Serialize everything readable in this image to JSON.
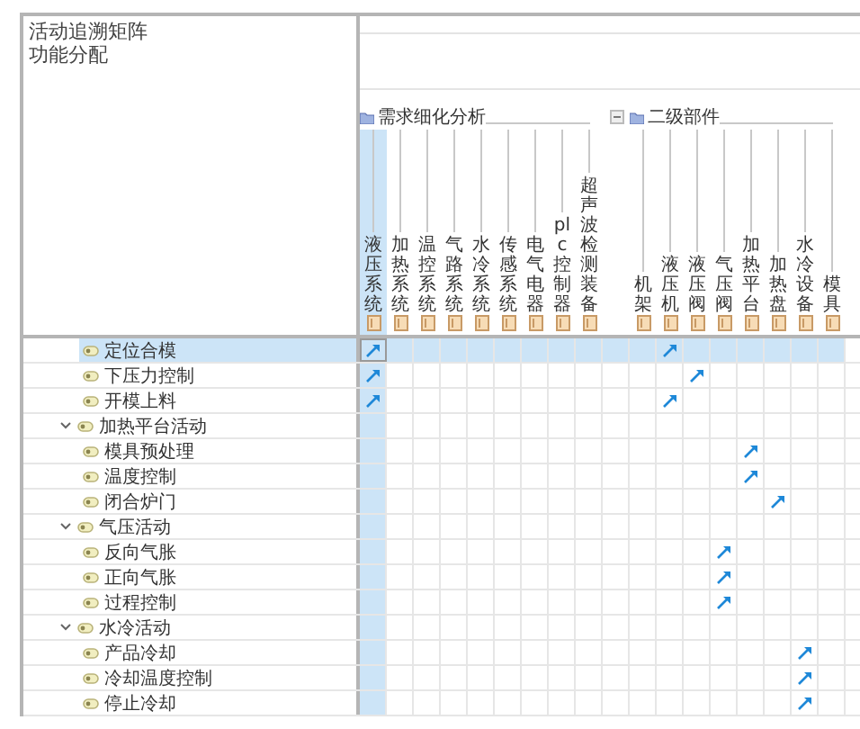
{
  "matrix": {
    "title": "活动追溯矩阵",
    "subtitle": "功能分配",
    "column_groups": [
      {
        "label": "需求细化分析",
        "columns": [
          {
            "label": "液压系统",
            "selected": true
          },
          {
            "label": "加热系统",
            "selected": false
          },
          {
            "label": "温控系统",
            "selected": false
          },
          {
            "label": "气路系统",
            "selected": false
          },
          {
            "label": "水冷系统",
            "selected": false
          },
          {
            "label": "传感系统",
            "selected": false
          },
          {
            "label": "电气电器",
            "selected": false
          },
          {
            "label": "plc控制器",
            "selected": false
          },
          {
            "label": "超声波检测装备",
            "selected": false
          }
        ]
      },
      {
        "label": "二级部件",
        "columns": [
          {
            "label": "机架",
            "selected": false
          },
          {
            "label": "液压机",
            "selected": false
          },
          {
            "label": "液压阀",
            "selected": false
          },
          {
            "label": "气压阀",
            "selected": false
          },
          {
            "label": "加热平台",
            "selected": false
          },
          {
            "label": "加热盘",
            "selected": false
          },
          {
            "label": "水冷设备",
            "selected": false
          },
          {
            "label": "模具",
            "selected": false
          }
        ]
      }
    ],
    "rows": [
      {
        "label": "定位合模",
        "selected": true,
        "cells": [
          true,
          false,
          false,
          false,
          false,
          false,
          false,
          false,
          false,
          false,
          true,
          false,
          false,
          false,
          false,
          false,
          false
        ]
      },
      {
        "label": "下压力控制",
        "selected": false,
        "cells": [
          true,
          false,
          false,
          false,
          false,
          false,
          false,
          false,
          false,
          false,
          false,
          true,
          false,
          false,
          false,
          false,
          false
        ]
      },
      {
        "label": "开模上料",
        "selected": false,
        "cells": [
          true,
          false,
          false,
          false,
          false,
          false,
          false,
          false,
          false,
          false,
          true,
          false,
          false,
          false,
          false,
          false,
          false
        ]
      },
      {
        "label": "加热平台活动",
        "selected": false,
        "expanded": true,
        "cells": [
          false,
          false,
          false,
          false,
          false,
          false,
          false,
          false,
          false,
          false,
          false,
          false,
          false,
          false,
          false,
          false,
          false
        ],
        "children": [
          {
            "label": "模具预处理",
            "selected": false,
            "cells": [
              false,
              false,
              false,
              false,
              false,
              false,
              false,
              false,
              false,
              false,
              false,
              false,
              false,
              true,
              false,
              false,
              false
            ]
          },
          {
            "label": "温度控制",
            "selected": false,
            "cells": [
              false,
              false,
              false,
              false,
              false,
              false,
              false,
              false,
              false,
              false,
              false,
              false,
              false,
              true,
              false,
              false,
              false
            ]
          },
          {
            "label": "闭合炉门",
            "selected": false,
            "cells": [
              false,
              false,
              false,
              false,
              false,
              false,
              false,
              false,
              false,
              false,
              false,
              false,
              false,
              false,
              true,
              false,
              false
            ]
          }
        ]
      },
      {
        "label": "气压活动",
        "selected": false,
        "expanded": true,
        "cells": [
          false,
          false,
          false,
          false,
          false,
          false,
          false,
          false,
          false,
          false,
          false,
          false,
          false,
          false,
          false,
          false,
          false
        ],
        "children": [
          {
            "label": "反向气胀",
            "selected": false,
            "cells": [
              false,
              false,
              false,
              false,
              false,
              false,
              false,
              false,
              false,
              false,
              false,
              false,
              true,
              false,
              false,
              false,
              false
            ]
          },
          {
            "label": "正向气胀",
            "selected": false,
            "cells": [
              false,
              false,
              false,
              false,
              false,
              false,
              false,
              false,
              false,
              false,
              false,
              false,
              true,
              false,
              false,
              false,
              false
            ]
          },
          {
            "label": "过程控制",
            "selected": false,
            "cells": [
              false,
              false,
              false,
              false,
              false,
              false,
              false,
              false,
              false,
              false,
              false,
              false,
              true,
              false,
              false,
              false,
              false
            ]
          }
        ]
      },
      {
        "label": "水冷活动",
        "selected": false,
        "expanded": true,
        "cells": [
          false,
          false,
          false,
          false,
          false,
          false,
          false,
          false,
          false,
          false,
          false,
          false,
          false,
          false,
          false,
          false,
          false
        ],
        "children": [
          {
            "label": "产品冷却",
            "selected": false,
            "cells": [
              false,
              false,
              false,
              false,
              false,
              false,
              false,
              false,
              false,
              false,
              false,
              false,
              false,
              false,
              false,
              true,
              false
            ]
          },
          {
            "label": "冷却温度控制",
            "selected": false,
            "cells": [
              false,
              false,
              false,
              false,
              false,
              false,
              false,
              false,
              false,
              false,
              false,
              false,
              false,
              false,
              false,
              true,
              false
            ]
          },
          {
            "label": "停止冷却",
            "selected": false,
            "cells": [
              false,
              false,
              false,
              false,
              false,
              false,
              false,
              false,
              false,
              false,
              false,
              false,
              false,
              false,
              false,
              true,
              false
            ]
          }
        ]
      }
    ]
  }
}
